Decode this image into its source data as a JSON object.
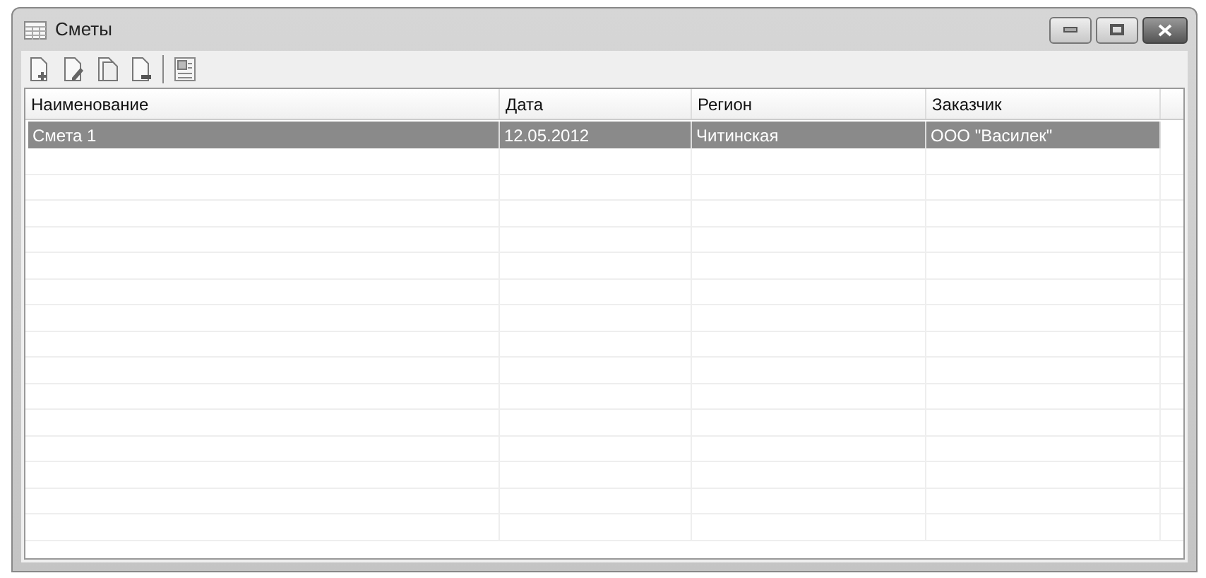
{
  "window": {
    "title": "Сметы"
  },
  "toolbar": [
    {
      "kind": "add"
    },
    {
      "kind": "edit"
    },
    {
      "kind": "copy"
    },
    {
      "kind": "remove"
    },
    {
      "kind": "export"
    }
  ],
  "table": {
    "columns": [
      "Наименование",
      "Дата",
      "Регион",
      "Заказчик"
    ],
    "rows": [
      {
        "selected": true,
        "cells": [
          "Смета 1",
          "12.05.2012",
          "Читинская",
          "ООО \"Василек\""
        ]
      }
    ]
  }
}
